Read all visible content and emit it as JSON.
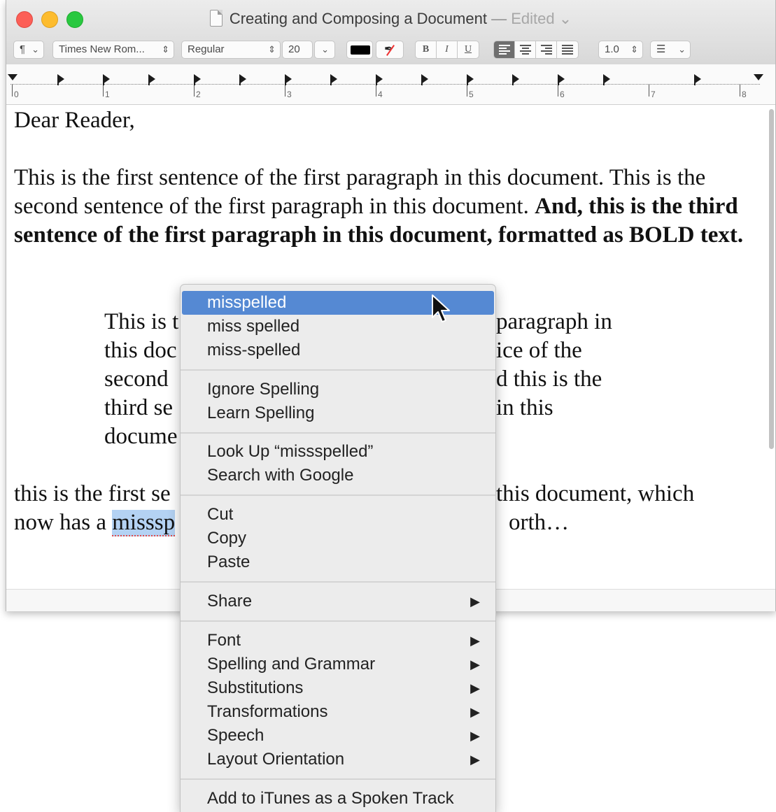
{
  "window": {
    "title": "Creating and Composing a Document",
    "title_separator": "—",
    "edited_label": "Edited",
    "edited_chevron": "⌄"
  },
  "format_bar": {
    "paragraph_style": "¶",
    "font_family": "Times New Rom...",
    "typeface": "Regular",
    "font_size": "20",
    "text_color": "#000000",
    "bold": "B",
    "italic": "I",
    "underline": "U",
    "line_spacing": "1.0",
    "alignment_selected": "left"
  },
  "ruler": {
    "numbers": [
      "0",
      "1",
      "2",
      "3",
      "4",
      "5",
      "6",
      "7",
      "8"
    ]
  },
  "document": {
    "greeting": "Dear Reader,",
    "para1_plain": "This is the first sentence of the first paragraph in this document. This is the second sentence of the first paragraph in this document. ",
    "para1_bold": "And, this is the third sentence of the first paragraph in this document, formatted as BOLD text.",
    "para2_lines": [
      "This is t",
      "this doc",
      "second ",
      "third se",
      "docume"
    ],
    "para2_right_lines": [
      "paragraph in",
      "ice of the",
      "d this is the",
      "in this"
    ],
    "para3_line1_left": "this is the first se",
    "para3_line1_right": " this document, which",
    "para3_line2_left": "now has a ",
    "para3_line2_selected": "misssp",
    "para3_line2_right": "orth…"
  },
  "context_menu": {
    "suggestions": [
      "misspelled",
      "miss spelled",
      "miss-spelled"
    ],
    "ignore_spelling": "Ignore Spelling",
    "learn_spelling": "Learn Spelling",
    "look_up": "Look Up “missspelled”",
    "search_google": "Search with Google",
    "cut": "Cut",
    "copy": "Copy",
    "paste": "Paste",
    "share": "Share",
    "font": "Font",
    "spelling_grammar": "Spelling and Grammar",
    "substitutions": "Substitutions",
    "transformations": "Transformations",
    "speech": "Speech",
    "layout_orientation": "Layout Orientation",
    "add_itunes": "Add to iTunes as a Spoken Track",
    "submenu_arrow": "▶"
  },
  "colors": {
    "highlight": "#5589d3",
    "selection": "#b4d2f3",
    "close": "#fc5f57",
    "minimize": "#fdbc2e",
    "zoom": "#29c840"
  }
}
